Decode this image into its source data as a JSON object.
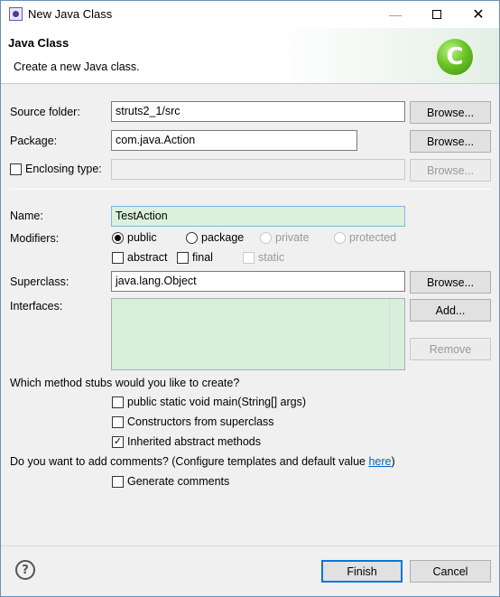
{
  "window": {
    "title": "New Java Class",
    "icon": "eclipse-app-icon"
  },
  "banner": {
    "title": "Java Class",
    "subtitle": "Create a new Java class.",
    "logo_letter": "C",
    "logo_color": "#5fbf1f"
  },
  "form": {
    "source_folder": {
      "label": "Source folder:",
      "value": "struts2_1/src",
      "button": "Browse..."
    },
    "package": {
      "label": "Package:",
      "value": "com.java.Action",
      "button": "Browse..."
    },
    "enclosing_type": {
      "label": "Enclosing type:",
      "value": "",
      "button": "Browse...",
      "checked": false
    },
    "name": {
      "label": "Name:",
      "value": "TestAction"
    },
    "modifiers": {
      "label": "Modifiers:",
      "public": "public",
      "package": "package",
      "private": "private",
      "protected": "protected",
      "abstract": "abstract",
      "final": "final",
      "static": "static",
      "selected": "public"
    },
    "superclass": {
      "label": "Superclass:",
      "value": "java.lang.Object",
      "button": "Browse..."
    },
    "interfaces": {
      "label": "Interfaces:",
      "add_button": "Add...",
      "remove_button": "Remove"
    },
    "stubs": {
      "question": "Which method stubs would you like to create?",
      "main": {
        "label": "public static void main(String[] args)",
        "checked": false
      },
      "constructors": {
        "label": "Constructors from superclass",
        "checked": false
      },
      "inherited": {
        "label": "Inherited abstract methods",
        "checked": true
      }
    },
    "comments": {
      "question_prefix": "Do you want to add comments? (Configure templates and default value ",
      "link": "here",
      "question_suffix": ")",
      "generate": {
        "label": "Generate comments",
        "checked": false
      }
    }
  },
  "footer": {
    "finish": "Finish",
    "cancel": "Cancel",
    "help_glyph": "?"
  }
}
